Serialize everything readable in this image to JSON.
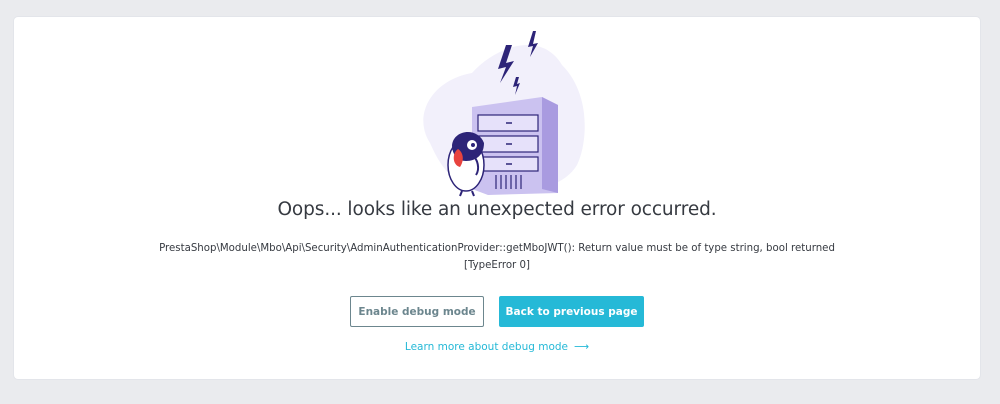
{
  "error": {
    "title": "Oops... looks like an unexpected error occurred.",
    "message_line1": "PrestaShop\\Module\\Mbo\\Api\\Security\\AdminAuthenticationProvider::getMboJWT(): Return value must be of type string, bool returned",
    "message_line2": "[TypeError 0]"
  },
  "actions": {
    "enable_debug_label": "Enable debug mode",
    "back_label": "Back to previous page",
    "learn_more_label": "Learn more about debug mode",
    "learn_more_arrow": "⟶"
  },
  "illustration": {
    "icon": "server-error-illustration",
    "colors": {
      "blob": "#f2f0fb",
      "server": "#cbc2f0",
      "server_dark": "#2d2478",
      "bird_beak": "#e8433e"
    }
  },
  "colors": {
    "primary": "#25b9d7",
    "secondary": "#6c868e",
    "text": "#363a41",
    "background": "#eaebee"
  }
}
